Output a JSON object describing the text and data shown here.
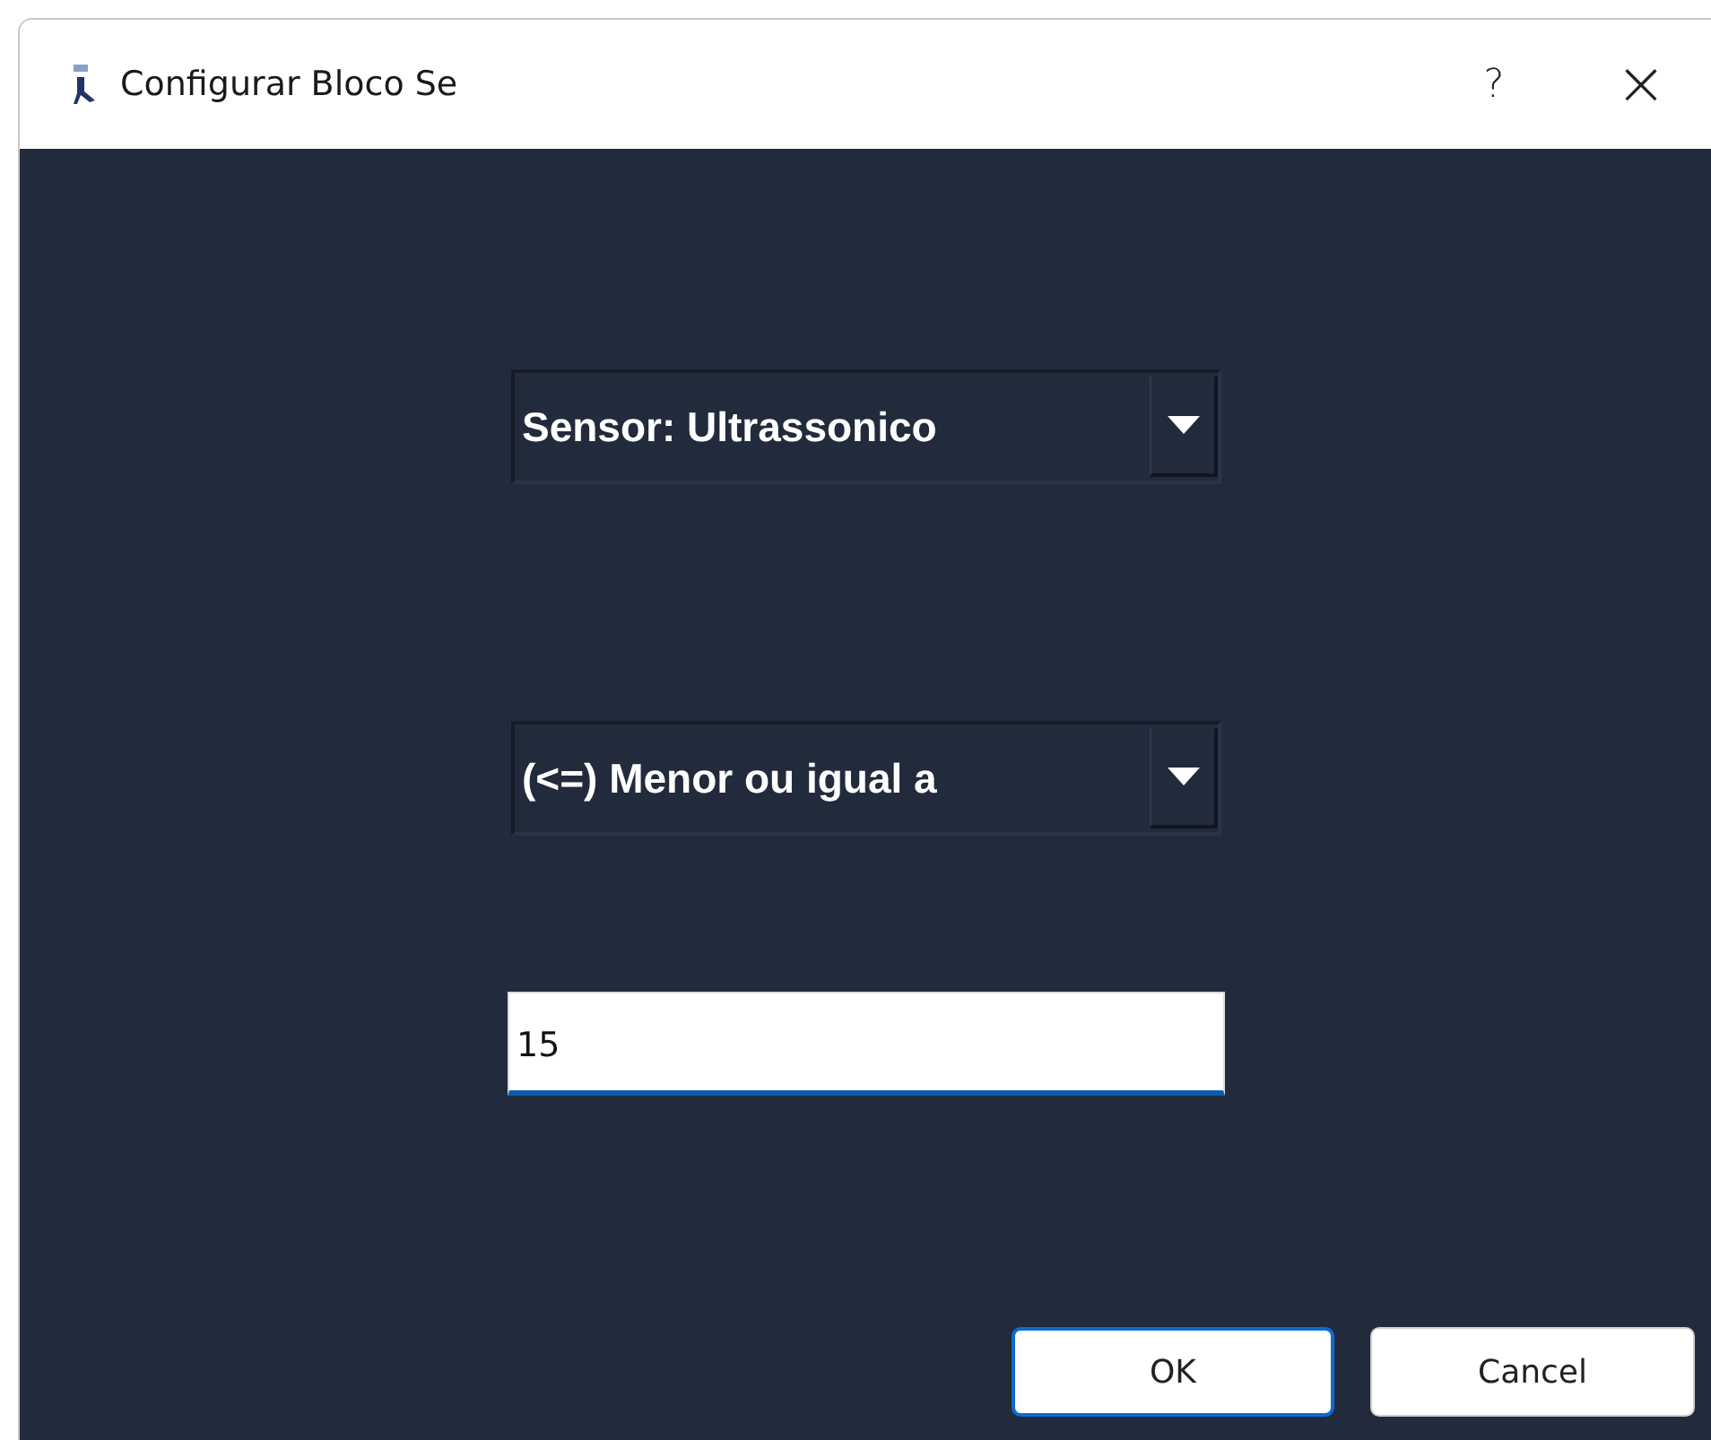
{
  "window": {
    "title": "Configurar Bloco Se",
    "help": "?",
    "close": "×"
  },
  "selects": [
    {
      "value": "Sensor: Ultrassonico"
    },
    {
      "value": "(<=) Menor ou igual a"
    }
  ],
  "input": {
    "value": "15",
    "focused": true
  },
  "buttons": [
    {
      "label": "OK",
      "default": true
    },
    {
      "label": "Cancel",
      "default": false
    }
  ]
}
